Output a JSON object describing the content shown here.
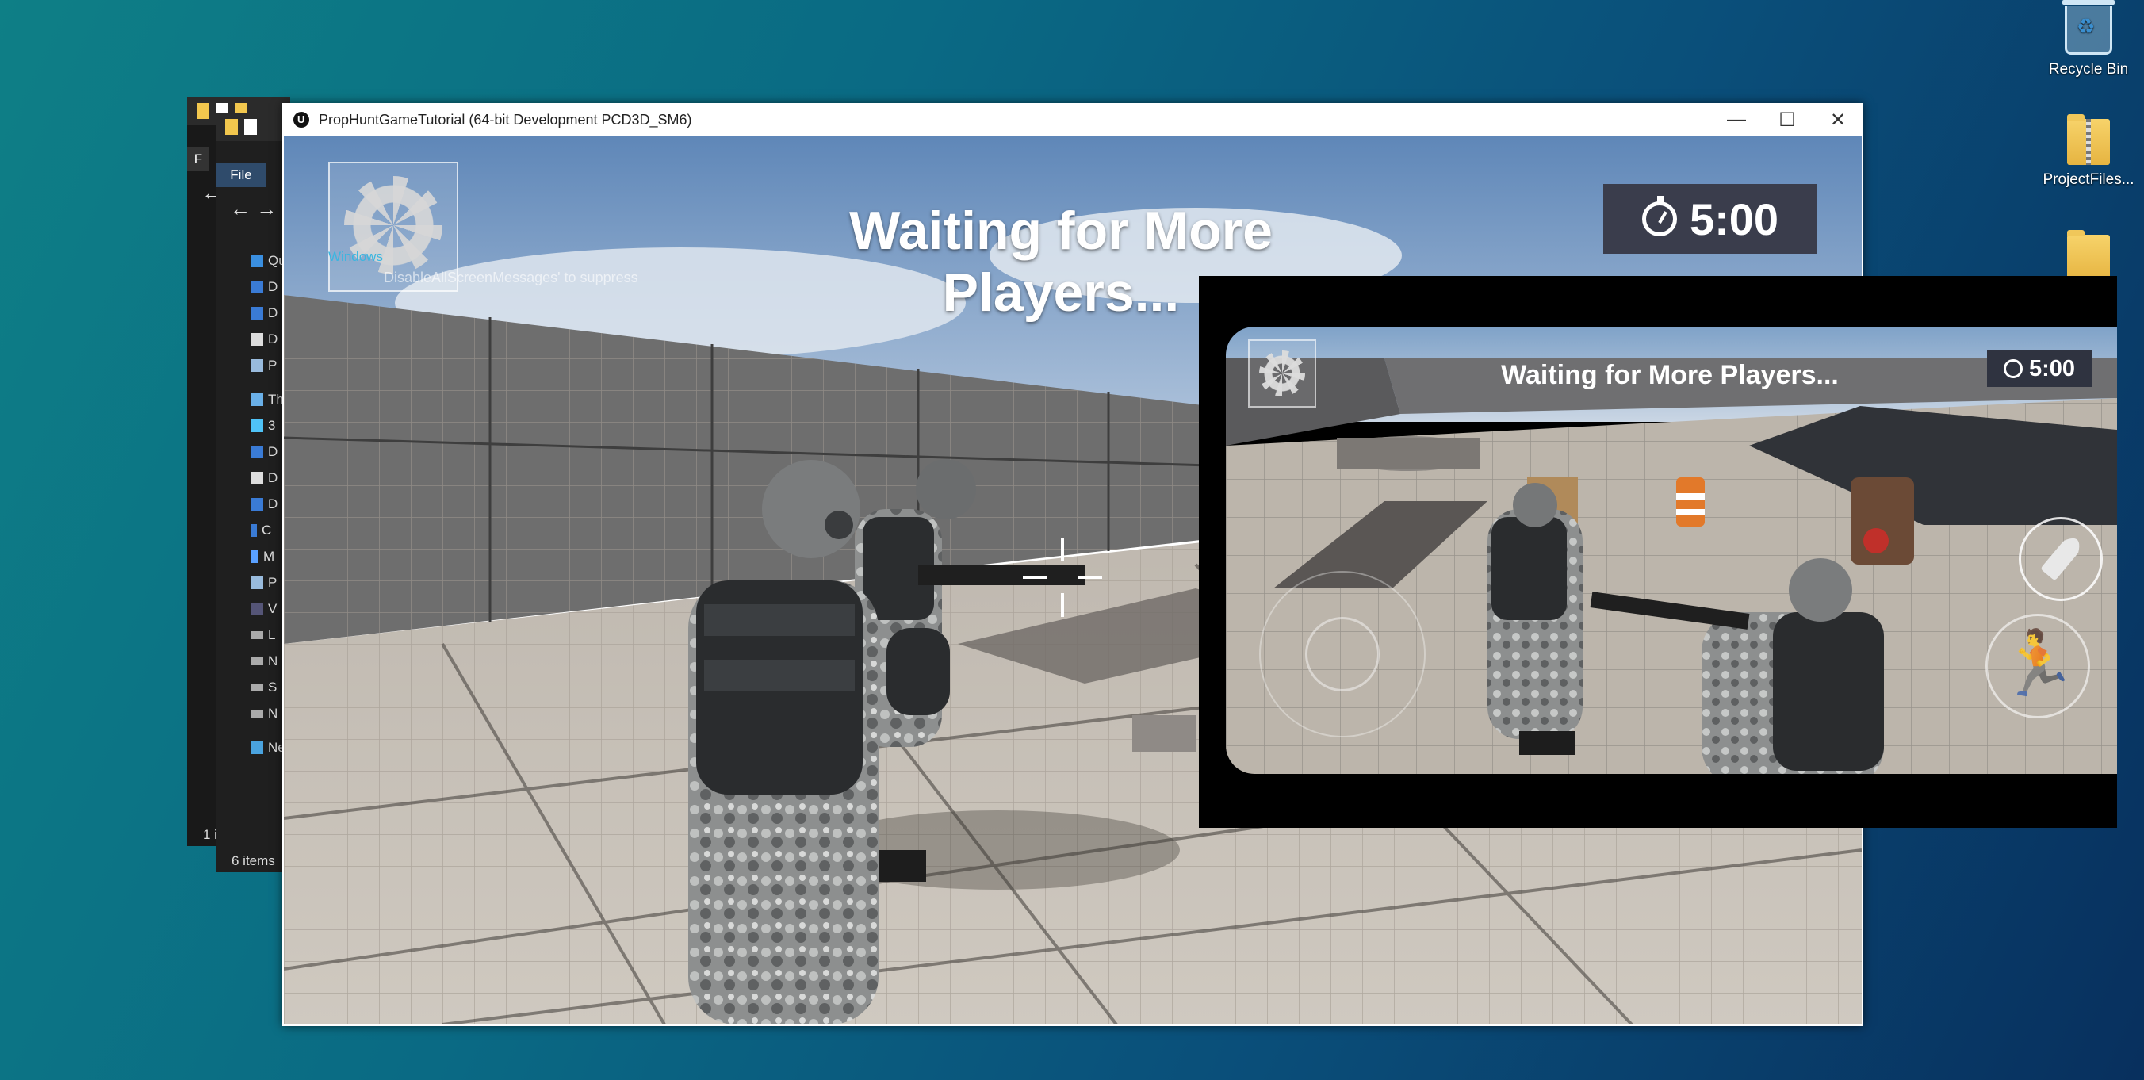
{
  "desktop": {
    "icons": [
      {
        "label": "Recycle Bin",
        "icon": "recycle-bin-icon"
      },
      {
        "label": "ProjectFiles...",
        "icon": "zip-folder-icon"
      },
      {
        "label": "",
        "icon": "folder-icon"
      }
    ]
  },
  "explorer_back": {
    "status": "1 i",
    "tab_prefix": "F"
  },
  "explorer_front": {
    "menu_file": "File",
    "tree": [
      {
        "label": "Qu",
        "icon": "star-icon"
      },
      {
        "label": "D",
        "icon": "desktop-icon"
      },
      {
        "label": "D",
        "icon": "download-icon"
      },
      {
        "label": "D",
        "icon": "document-icon"
      },
      {
        "label": "P",
        "icon": "picture-icon"
      },
      {
        "label": "Th",
        "icon": "computer-icon"
      },
      {
        "label": "3",
        "icon": "cube-icon"
      },
      {
        "label": "D",
        "icon": "desktop-icon"
      },
      {
        "label": "D",
        "icon": "document-icon"
      },
      {
        "label": "D",
        "icon": "download-icon"
      },
      {
        "label": "C",
        "icon": "drive-icon"
      },
      {
        "label": "M",
        "icon": "music-icon"
      },
      {
        "label": "P",
        "icon": "picture-icon"
      },
      {
        "label": "V",
        "icon": "video-icon"
      },
      {
        "label": "L",
        "icon": "disk-icon"
      },
      {
        "label": "N",
        "icon": "disk-icon"
      },
      {
        "label": "S",
        "icon": "disk-icon"
      },
      {
        "label": "N",
        "icon": "disk-icon"
      },
      {
        "label": "Ne",
        "icon": "network-icon"
      }
    ],
    "status": "6 items"
  },
  "game_window": {
    "title": "PropHuntGameTutorial (64-bit Development PCD3D_SM6)",
    "controls": {
      "minimize": "—",
      "maximize": "☐",
      "close": "✕"
    }
  },
  "hud": {
    "settings_overlay_label": "Windows",
    "debug_message": "DisableAllScreenMessages' to suppress",
    "waiting_text": "Waiting for More Players...",
    "timer": "5:00"
  },
  "mobile_preview": {
    "waiting_text": "Waiting for More Players...",
    "timer": "5:00"
  },
  "colors": {
    "desktop_teal": "#0e7f86",
    "desktop_navy": "#08305e",
    "timer_bg": "#3a3d4c",
    "windows_label": "#3ab6e0"
  }
}
